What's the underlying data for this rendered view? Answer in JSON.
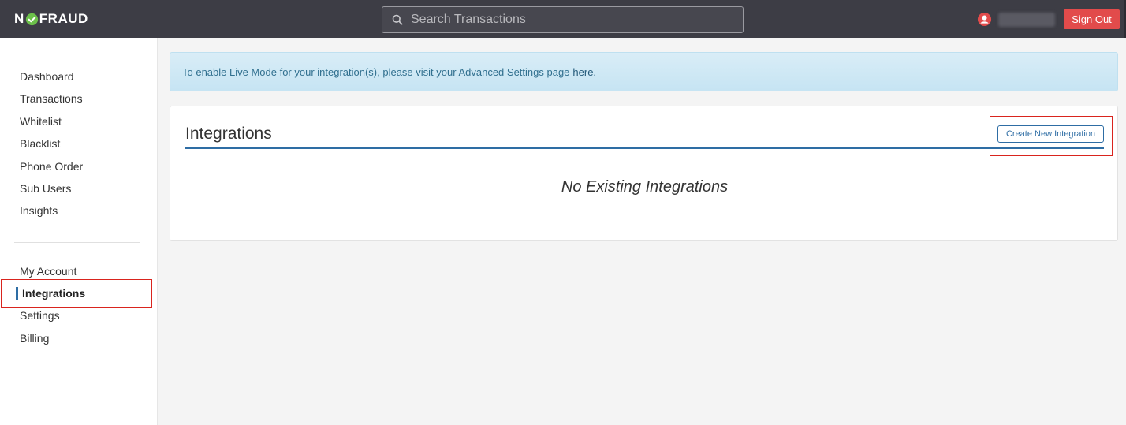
{
  "header": {
    "logo_left": "N",
    "logo_right": "FRAUD",
    "search_placeholder": "Search Transactions",
    "sign_out_label": "Sign Out"
  },
  "sidebar": {
    "primary": [
      "Dashboard",
      "Transactions",
      "Whitelist",
      "Blacklist",
      "Phone Order",
      "Sub Users",
      "Insights"
    ],
    "secondary": [
      "My Account",
      "Integrations",
      "Settings",
      "Billing"
    ],
    "active": "Integrations"
  },
  "alert": {
    "text": "To enable Live Mode for your integration(s), please visit your Advanced Settings page",
    "link_text": "here."
  },
  "panel": {
    "title": "Integrations",
    "create_button_label": "Create New Integration",
    "empty_message": "No Existing Integrations"
  },
  "colors": {
    "topbar": "#3d3d45",
    "accent": "#2e6da4",
    "sign_out": "#e24b4b",
    "alert_bg": "#d9edf7",
    "highlight": "#d9241e",
    "logo_check": "#6cc04a"
  }
}
